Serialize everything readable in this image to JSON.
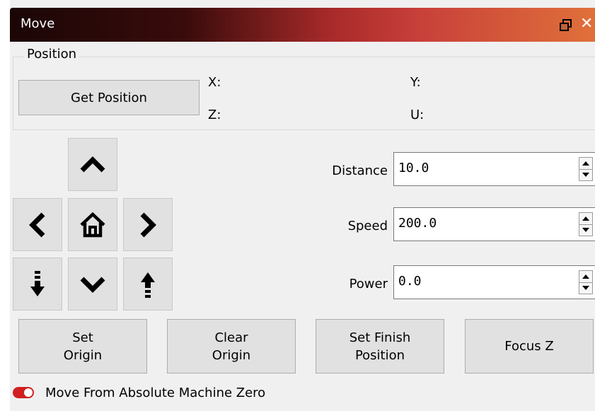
{
  "window": {
    "title": "Move"
  },
  "position_group": {
    "legend": "Position",
    "get_position_label": "Get Position",
    "x_label": "X:",
    "y_label": "Y:",
    "z_label": "Z:",
    "u_label": "U:"
  },
  "jog_pad": {
    "icons": [
      "chevron-up-icon",
      "chevron-left-icon",
      "home-icon",
      "chevron-right-icon",
      "z-down-icon",
      "chevron-down-icon",
      "z-up-icon"
    ]
  },
  "fields": {
    "distance": {
      "label": "Distance",
      "value": "10.0"
    },
    "speed": {
      "label": "Speed",
      "value": "200.0"
    },
    "power": {
      "label": "Power",
      "value": "0.0"
    }
  },
  "buttons": {
    "set_origin": "Set\nOrigin",
    "clear_origin": "Clear\nOrigin",
    "set_finish_position": "Set Finish\nPosition",
    "focus_z": "Focus Z"
  },
  "options": {
    "move_from_absolute_zero": {
      "label": "Move From Absolute Machine Zero",
      "checked": true
    }
  },
  "colors": {
    "toggle_on": "#d02020",
    "title_gradient_start": "#1b0606",
    "title_gradient_end": "#e0703a"
  }
}
